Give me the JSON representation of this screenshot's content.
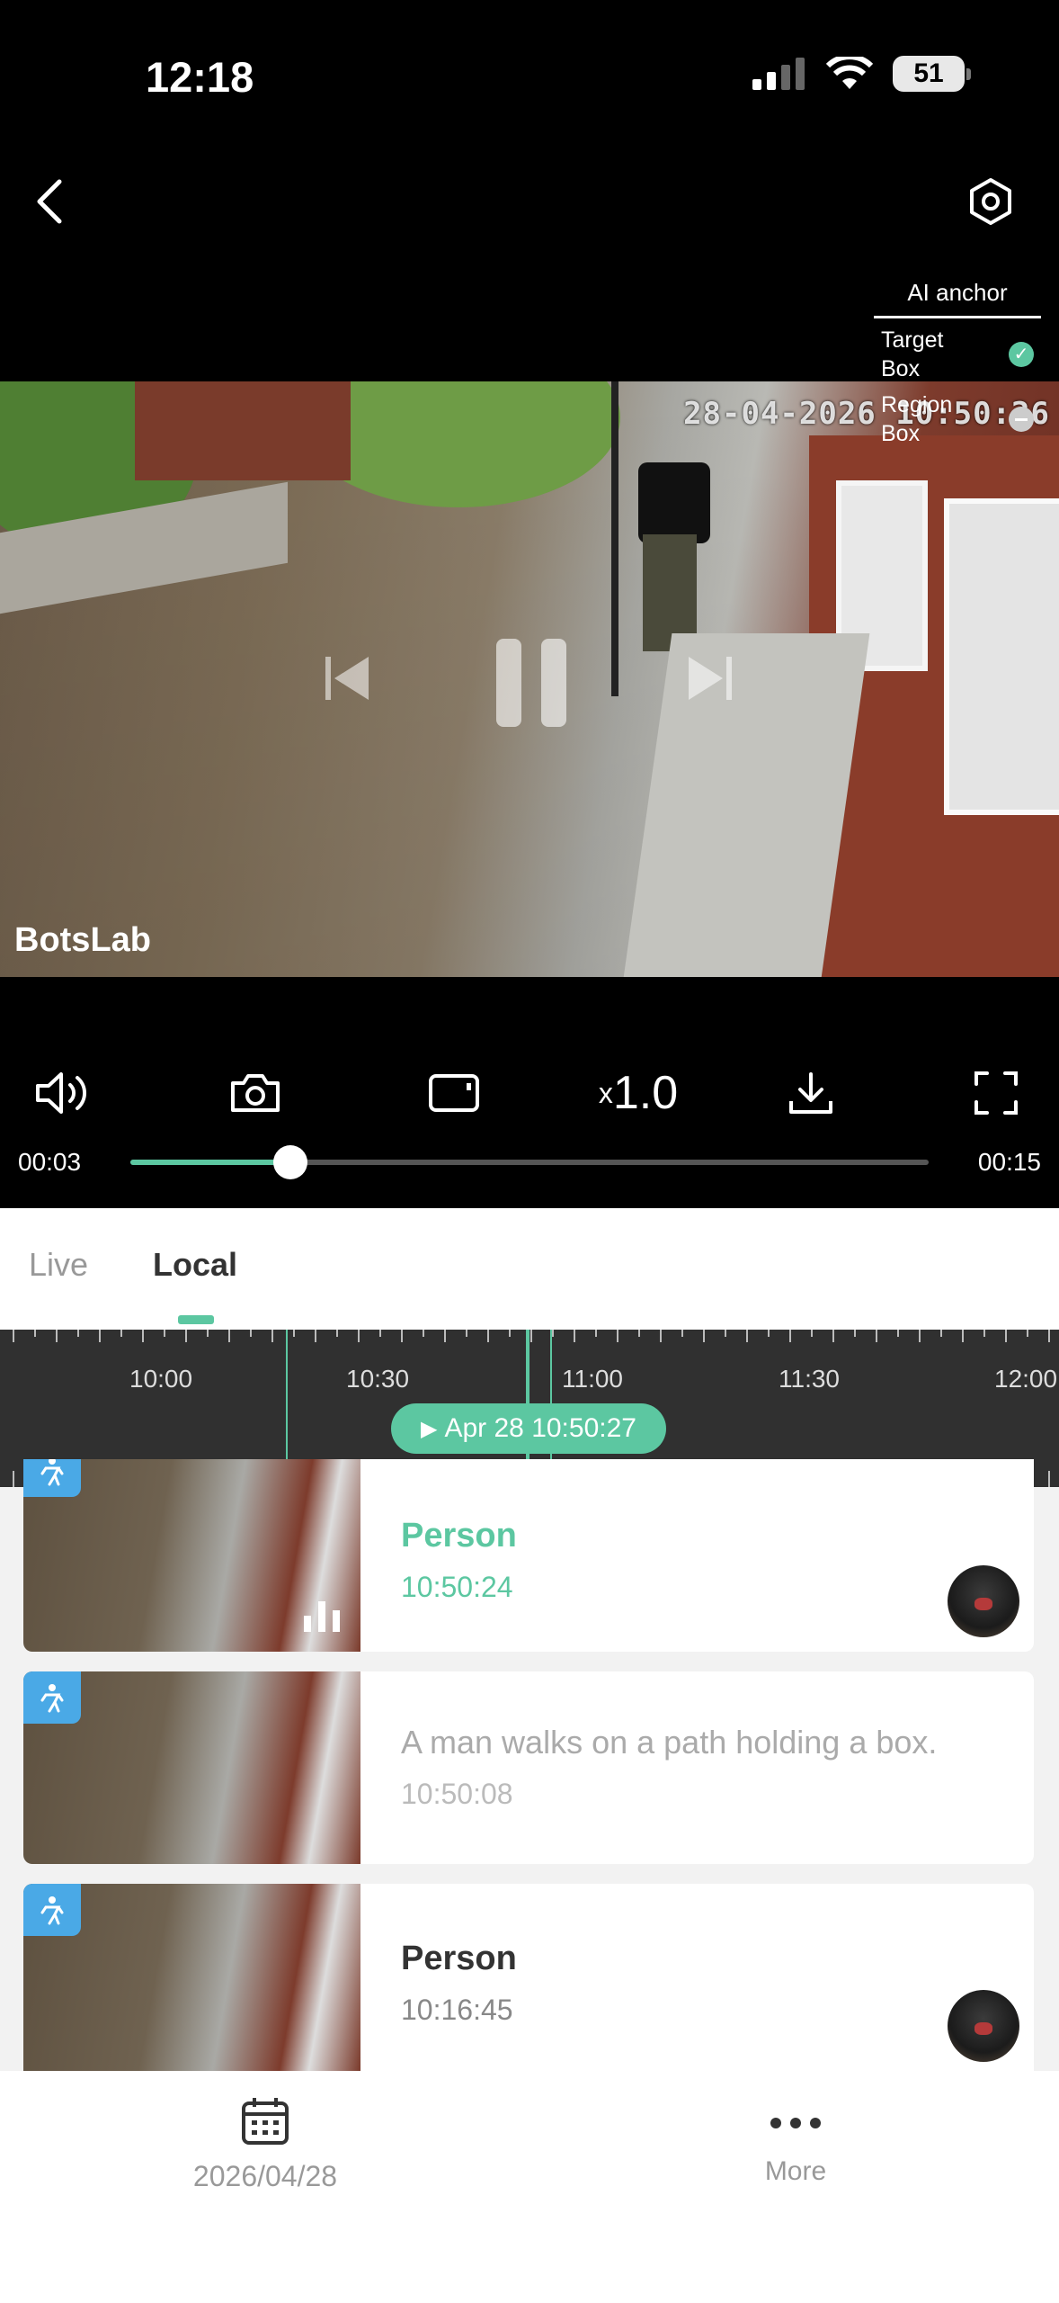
{
  "status_bar": {
    "time": "12:18",
    "battery": "51"
  },
  "player": {
    "timestamp": "28-04-2026 10:50:26",
    "brand": "BotsLab",
    "ai_anchor": {
      "title": "AI anchor",
      "options": [
        {
          "label": "Target Box",
          "checked": true
        },
        {
          "label": "Region Box",
          "checked": false
        }
      ]
    },
    "speed": "1.0",
    "speed_prefix": "x",
    "current_time": "00:03",
    "total_time": "00:15",
    "progress": 0.2
  },
  "tabs": [
    {
      "label": "Live",
      "active": false
    },
    {
      "label": "Local",
      "active": true
    }
  ],
  "timeline": {
    "labels": [
      "10:00",
      "10:30",
      "11:00",
      "11:30",
      "12:00"
    ],
    "current": "Apr 28 10:50:27"
  },
  "events": [
    {
      "title": "Person",
      "time": "10:50:24",
      "active": true
    },
    {
      "title": "A man walks on a path holding a box.",
      "time": "10:50:08",
      "active": false
    },
    {
      "title": "Person",
      "time": "10:16:45",
      "active": false
    }
  ],
  "bottom_bar": {
    "date": "2026/04/28",
    "more": "More"
  },
  "colors": {
    "accent": "#5cc7a1",
    "badge": "#4aa9e6"
  }
}
